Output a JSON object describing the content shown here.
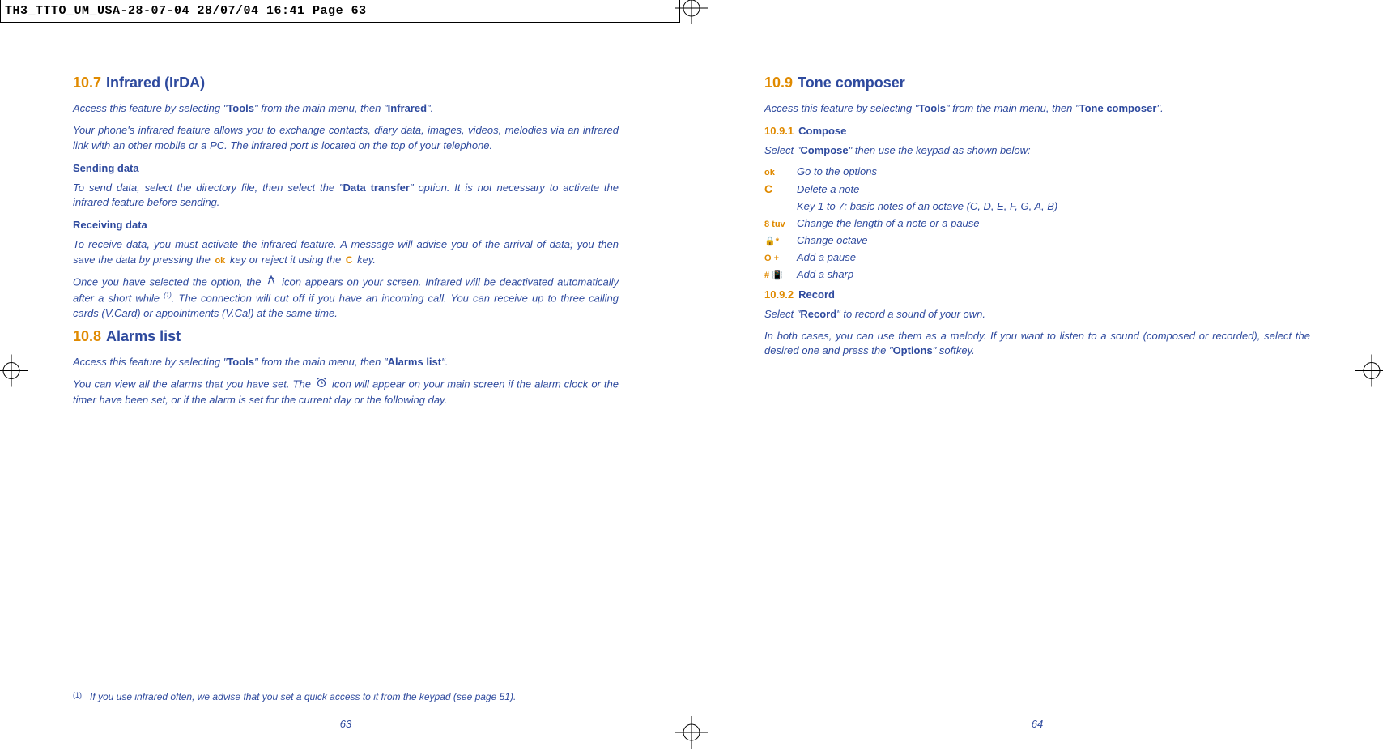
{
  "cropbar": "TH3_TTTO_UM_USA-28-07-04  28/07/04  16:41  Page 63",
  "left": {
    "s107": {
      "num": "10.7",
      "title": "Infrared (IrDA)"
    },
    "p107_access_pre": "Access this feature by selecting \"",
    "p107_access_tools": "Tools",
    "p107_access_mid": "\" from the main menu, then \"",
    "p107_access_feat": "Infrared",
    "p107_access_post": "\".",
    "p107_desc": "Your phone's infrared feature allows you to exchange contacts, diary data, images, videos, melodies via an infrared link with an other mobile or a PC. The infrared port is located on the top of your telephone.",
    "h_sending": "Sending data",
    "p_sending_pre": "To send data, select the directory file, then select the \"",
    "p_sending_bold": "Data transfer",
    "p_sending_post": "\" option. It is not necessary to activate the infrared feature before sending.",
    "h_receiving": "Receiving data",
    "p_recv_pre": "To receive data, you must activate the infrared feature. A message will advise you of the arrival of data; you then save the data by pressing the ",
    "ok_label": "ok",
    "p_recv_mid": " key or reject it using the ",
    "c_label": "C",
    "p_recv_post": " key.",
    "p_once_pre": "Once you have selected the option, the ",
    "p_once_post": " icon appears on your screen. Infrared will be deactivated automatically after a short while ",
    "p_once_cont": ". The connection will cut off if you have an incoming call. You can receive up to three calling cards (V.Card) or appointments (V.Cal) at the same time.",
    "s108": {
      "num": "10.8",
      "title": "Alarms list"
    },
    "p108_access_pre": "Access this feature by selecting \"",
    "p108_access_tools": "Tools",
    "p108_access_mid": "\" from the main menu, then \"",
    "p108_access_feat": "Alarms list",
    "p108_access_post": "\".",
    "p108_desc_pre": "You can view all the alarms that you have set. The ",
    "p108_desc_post": " icon will appear on your main screen if the alarm clock or the timer have been set, or if the alarm is set for the current day or the following day.",
    "footnote_mark": "(1)",
    "footnote_text": "If you use infrared often, we advise that you set a quick access to it from the keypad (see page 51).",
    "pagenum": "63"
  },
  "right": {
    "s109": {
      "num": "10.9",
      "title": "Tone composer"
    },
    "p109_access_pre": "Access this feature by selecting \"",
    "p109_access_tools": "Tools",
    "p109_access_mid": "\" from the main menu, then \"",
    "p109_access_feat": "Tone composer",
    "p109_access_post": "\".",
    "s1091": {
      "num": "10.9.1",
      "title": "Compose"
    },
    "p1091_pre": "Select \"",
    "p1091_bold": "Compose",
    "p1091_post": "\" then use the keypad as shown below:",
    "keys": [
      {
        "icon": "ok",
        "desc": "Go to the options"
      },
      {
        "icon": "C",
        "desc": "Delete a note"
      },
      {
        "icon": "",
        "desc": "Key 1 to 7: basic notes of an octave (C, D, E, F, G, A, B)"
      },
      {
        "icon": "8 tuv",
        "desc": "Change the length of a note or a pause"
      },
      {
        "icon": "🔒*",
        "desc": "Change octave"
      },
      {
        "icon": "O +",
        "desc": "Add a pause"
      },
      {
        "icon": "# 📳",
        "desc": "Add a sharp"
      }
    ],
    "s1092": {
      "num": "10.9.2",
      "title": "Record"
    },
    "p1092_pre": "Select \"",
    "p1092_bold": "Record",
    "p1092_post": "\" to record a sound of your own.",
    "p1092_final_pre": "In both cases, you can use them as a melody. If you want to listen to a sound (composed or recorded), select the desired one and press the \"",
    "p1092_final_bold": "Options",
    "p1092_final_post": "\" softkey.",
    "pagenum": "64"
  }
}
